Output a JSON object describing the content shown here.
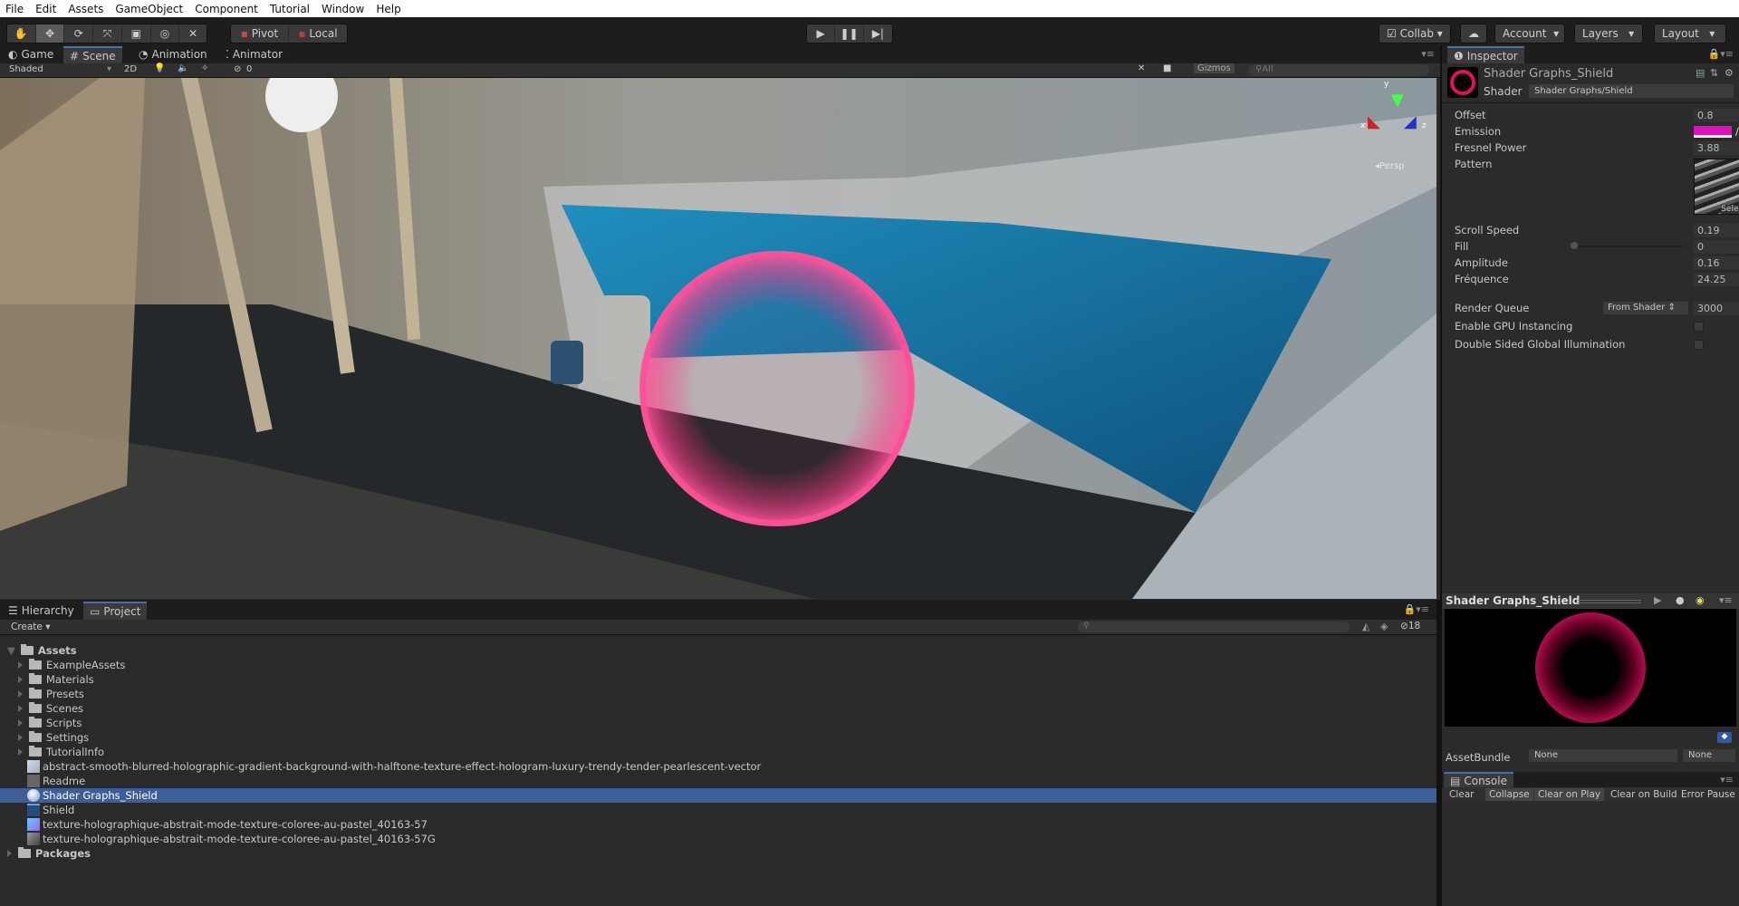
{
  "menu": [
    "File",
    "Edit",
    "Assets",
    "GameObject",
    "Component",
    "Tutorial",
    "Window",
    "Help"
  ],
  "toolbar": {
    "tools": [
      "hand-icon",
      "move-icon",
      "rotate-icon",
      "scale-icon",
      "rect-icon",
      "transform-icon",
      "custom-tool-icon"
    ],
    "pivot": "Pivot",
    "local": "Local",
    "collab": "Collab",
    "account": "Account",
    "layers": "Layers",
    "layout": "Layout"
  },
  "scene_tabs": [
    {
      "label": "Game",
      "icon": "game-icon"
    },
    {
      "label": "Scene",
      "icon": "scene-icon"
    },
    {
      "label": "Animation",
      "icon": "animation-icon"
    },
    {
      "label": "Animator",
      "icon": "animator-icon"
    }
  ],
  "scene_bar": {
    "shading": "Shaded",
    "mode_2d": "2D",
    "hidden_count": "0",
    "gizmos": "Gizmos",
    "search": "All"
  },
  "gizmo": {
    "x": "x",
    "y": "y",
    "z": "z",
    "projection": "Persp"
  },
  "inspector": {
    "tab": "Inspector",
    "material_name": "Shader Graphs_Shield",
    "shader_label": "Shader",
    "shader_value": "Shader Graphs/Shield",
    "props": {
      "offset": {
        "label": "Offset",
        "value": "0.8"
      },
      "emission": {
        "label": "Emission",
        "color": "#e010c0"
      },
      "fresnel": {
        "label": "Fresnel Power",
        "value": "3.88"
      },
      "pattern": {
        "label": "Pattern",
        "select": "Select"
      },
      "scroll": {
        "label": "Scroll Speed",
        "value": "0.19"
      },
      "fill": {
        "label": "Fill",
        "value": "0",
        "slider": 0
      },
      "amplitude": {
        "label": "Amplitude",
        "value": "0.16"
      },
      "frequence": {
        "label": "Fréquence",
        "value": "24.25"
      },
      "render_queue": {
        "label": "Render Queue",
        "mode": "From Shader",
        "value": "3000"
      },
      "gpu": {
        "label": "Enable GPU Instancing",
        "checked": false
      },
      "dsgi": {
        "label": "Double Sided Global Illumination",
        "checked": false
      }
    }
  },
  "preview": {
    "title": "Shader Graphs_Shield",
    "assetbundle_label": "AssetBundle",
    "bundle": "None",
    "variant": "None"
  },
  "console": {
    "tab": "Console",
    "buttons": [
      "Clear",
      "Collapse",
      "Clear on Play",
      "Clear on Build",
      "Error Pause"
    ]
  },
  "project": {
    "tabs": [
      "Hierarchy",
      "Project"
    ],
    "create": "Create",
    "hidden_count": "18",
    "root": "Assets",
    "folders": [
      "ExampleAssets",
      "Materials",
      "Presets",
      "Scenes",
      "Scripts",
      "Settings",
      "TutorialInfo"
    ],
    "files": [
      "abstract-smooth-blurred-holographic-gradient-background-with-halftone-texture-effect-hologram-luxury-trendy-tender-pearlescent-vector",
      "Readme",
      "Shader Graphs_Shield",
      "Shield",
      "texture-holographique-abstrait-mode-texture-coloree-au-pastel_40163-57",
      "texture-holographique-abstrait-mode-texture-coloree-au-pastel_40163-57G"
    ],
    "packages": "Packages",
    "selected": "Shader Graphs_Shield"
  }
}
